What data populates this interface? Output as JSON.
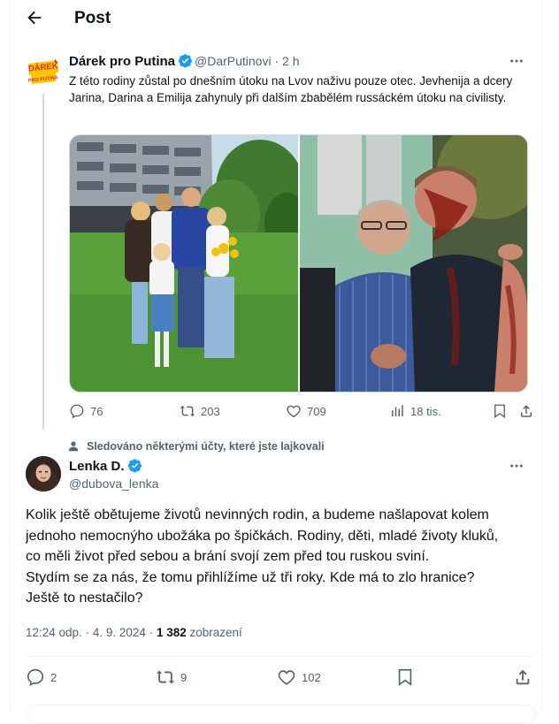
{
  "header": {
    "title": "Post"
  },
  "tweet1": {
    "logo_text_top": "DÁREK",
    "logo_text_bottom": "PRO PUTINA",
    "name": "Dárek pro Putina",
    "handle": "@DarPutinovi",
    "separator": "·",
    "time": "2 h",
    "text": "Z této rodiny zůstal po dnešním útoku na Lvov naživu pouze otec. Jevhenija a dcery Jarina, Darina a Emilija  zahynuly při dalším zbabělém russáckém útoku na civilisty.",
    "replies": "76",
    "retweets": "203",
    "likes": "709",
    "views": "18 tis."
  },
  "social_context": "Sledováno některými účty, které jste lajkovali",
  "tweet2": {
    "name": "Lenka D.",
    "handle": "@dubova_lenka",
    "lines": [
      "Kolik ještě obětujeme životů nevinných rodin, a budeme našlapovat kolem",
      "jednoho nemocnýho ubožáka po špičkách. Rodiny, děti, mladé životy kluků,",
      "co měli život před sebou a brání svojí zem před tou ruskou sviní.",
      "Stydím se za nás, že tomu přihlížíme už tři roky. Kde má to zlo hranice?",
      "Ještě to nestačilo?"
    ],
    "time": "12:24 odp.",
    "dot": "·",
    "date": "4. 9. 2024",
    "views_count": "1 382",
    "views_label": "zobrazení",
    "replies": "2",
    "retweets": "9",
    "likes": "102"
  },
  "colors": {
    "accent": "#1d9bf0",
    "muted": "#536471",
    "text": "#0f1419",
    "border": "#eff3f4"
  }
}
